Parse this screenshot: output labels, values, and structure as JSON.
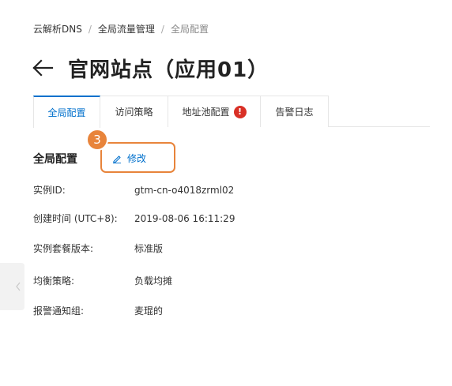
{
  "breadcrumb": {
    "items": [
      "云解析DNS",
      "全局流量管理",
      "全局配置"
    ],
    "separator": "/"
  },
  "header": {
    "title": "官网站点（应用01）",
    "back_icon": "arrow-left-icon"
  },
  "tabs": [
    {
      "label": "全局配置",
      "active": true
    },
    {
      "label": "访问策略",
      "active": false
    },
    {
      "label": "地址池配置",
      "active": false,
      "badge": "!"
    },
    {
      "label": "告警日志",
      "active": false
    }
  ],
  "section": {
    "title": "全局配置",
    "edit_label": "修改",
    "edit_icon": "pencil-icon",
    "step_number": "3"
  },
  "info": [
    {
      "label": "实例ID:",
      "value": "gtm-cn-o4018zrml02"
    },
    {
      "label": "创建时间 (UTC+8):",
      "value": "2019-08-06 16:11:29"
    },
    {
      "label": "实例套餐版本:",
      "value": "标准版"
    },
    {
      "label": "均衡策略:",
      "value": "负载均摊"
    },
    {
      "label": "报警通知组:",
      "value": "麦琨的"
    }
  ],
  "colors": {
    "accent": "#0070cc",
    "highlight": "#e8843b",
    "badge": "#d93026"
  }
}
